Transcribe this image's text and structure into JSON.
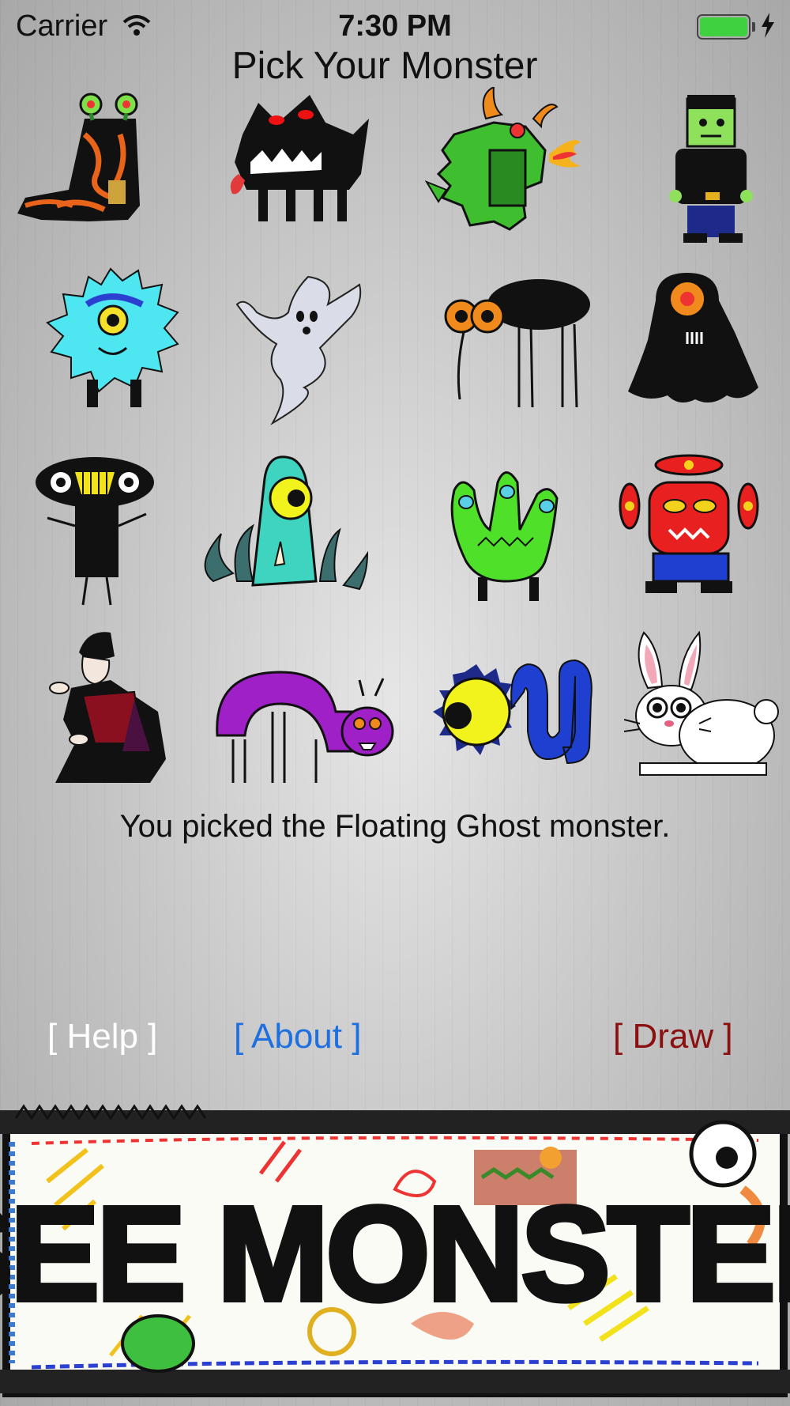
{
  "status_bar": {
    "carrier": "Carrier",
    "time": "7:30 PM",
    "battery_level": 1.0
  },
  "title": "Pick Your Monster",
  "monsters": [
    {
      "icon": "boot-monster-icon"
    },
    {
      "icon": "black-wolf-monster-icon"
    },
    {
      "icon": "green-dragon-monster-icon"
    },
    {
      "icon": "frankenstein-monster-icon"
    },
    {
      "icon": "cyan-furball-monster-icon"
    },
    {
      "icon": "floating-ghost-monster-icon"
    },
    {
      "icon": "black-spider-monster-icon"
    },
    {
      "icon": "black-cyclops-monster-icon"
    },
    {
      "icon": "black-goggle-monster-icon"
    },
    {
      "icon": "teal-blob-monster-icon"
    },
    {
      "icon": "green-hand-monster-icon"
    },
    {
      "icon": "red-robot-monster-icon"
    },
    {
      "icon": "vampire-monster-icon"
    },
    {
      "icon": "purple-worm-monster-icon"
    },
    {
      "icon": "eyeball-serpent-monster-icon"
    },
    {
      "icon": "white-rabbit-monster-icon"
    }
  ],
  "picked_message": "You picked the Floating Ghost monster.",
  "buttons": {
    "help": "[ Help ]",
    "about": "[ About ]",
    "draw": "[ Draw ]"
  },
  "logo_text": "SEE MONSTER",
  "colors": {
    "help": "#ffffff",
    "about": "#1e6fe0",
    "draw": "#8b1010"
  }
}
